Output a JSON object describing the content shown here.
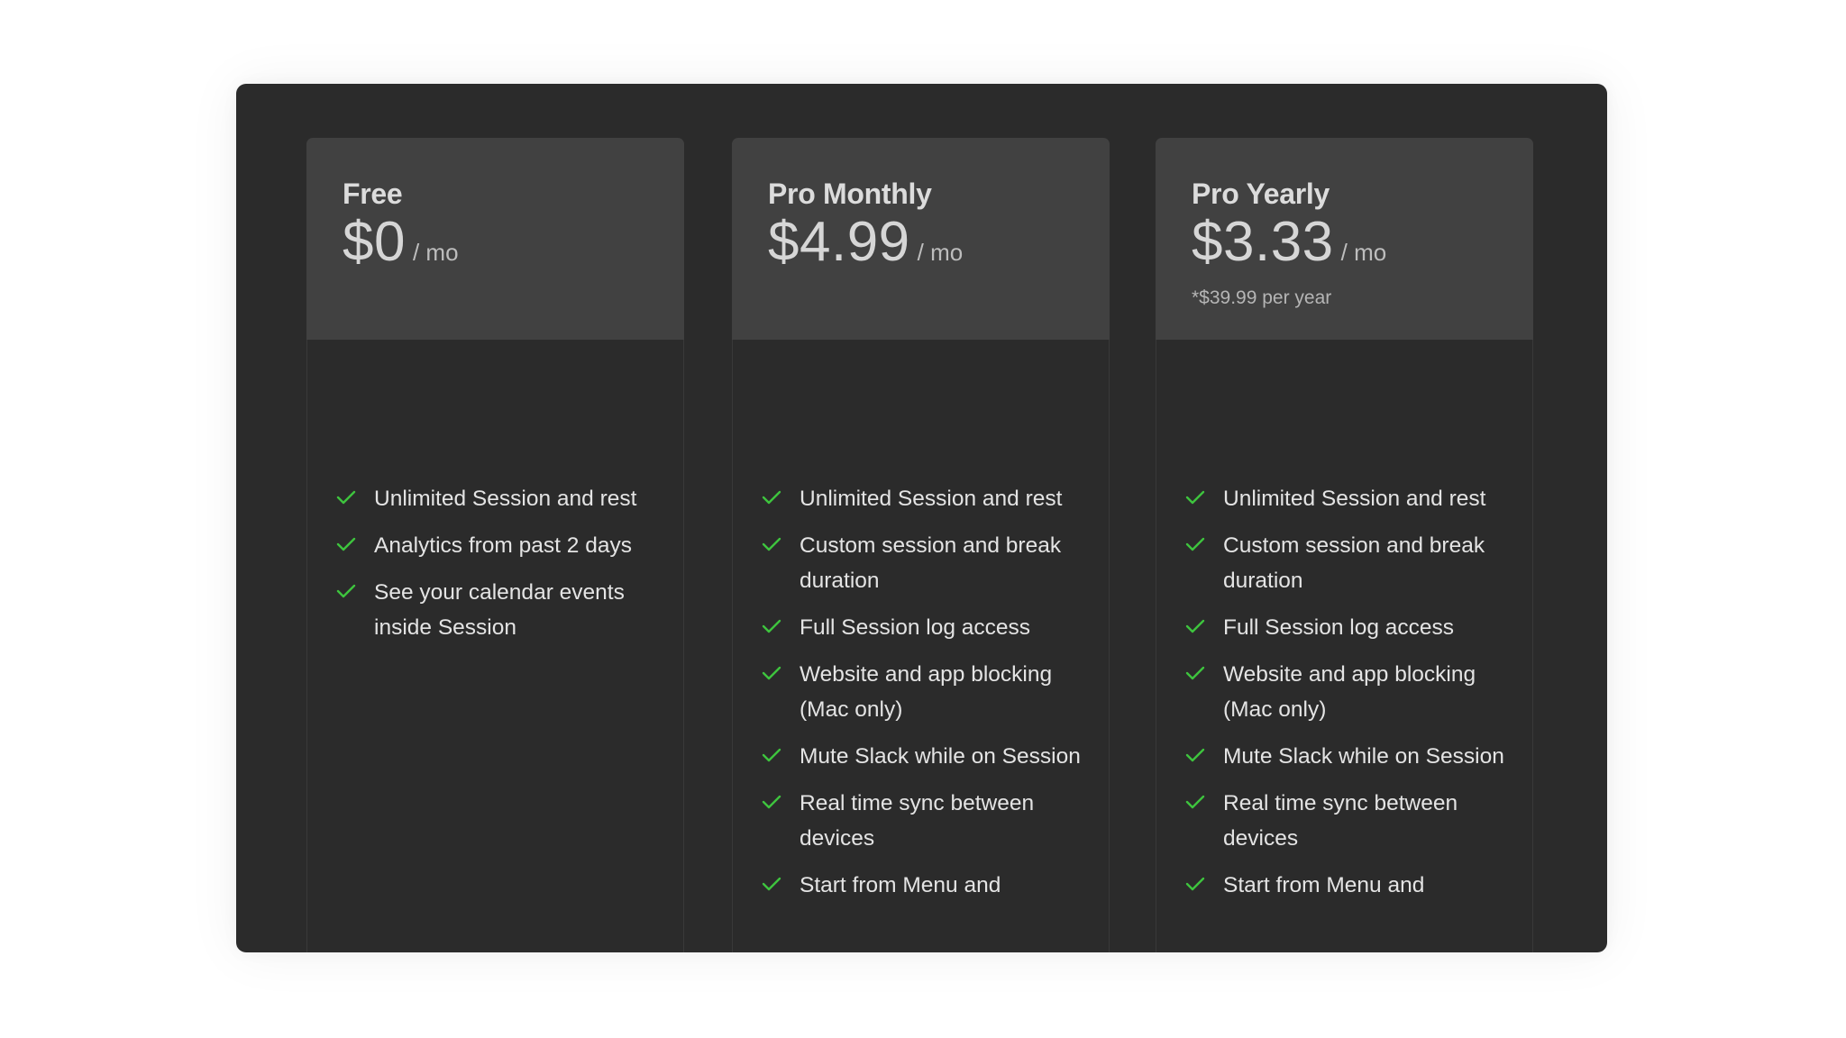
{
  "colors": {
    "window_bg": "#2b2b2b",
    "card_header_bg": "#414141",
    "check_green": "#3ec43e"
  },
  "plans": [
    {
      "name": "Free",
      "price": "$0",
      "period": "/ mo",
      "footnote": "",
      "features": [
        "Unlimited Session and rest",
        "Analytics from past 2 days",
        "See your calendar events inside Session"
      ]
    },
    {
      "name": "Pro Monthly",
      "price": "$4.99",
      "period": "/ mo",
      "footnote": "",
      "features": [
        "Unlimited Session and rest",
        "Custom session and break duration",
        "Full Session log access",
        "Website and app blocking (Mac only)",
        "Mute Slack while on Session",
        "Real time sync between devices",
        "Start from Menu and"
      ]
    },
    {
      "name": "Pro Yearly",
      "price": "$3.33",
      "period": "/ mo",
      "footnote": "*$39.99 per year",
      "features": [
        "Unlimited Session and rest",
        "Custom session and break duration",
        "Full Session log access",
        "Website and app blocking (Mac only)",
        "Mute Slack while on Session",
        "Real time sync between devices",
        "Start from Menu and"
      ]
    }
  ]
}
